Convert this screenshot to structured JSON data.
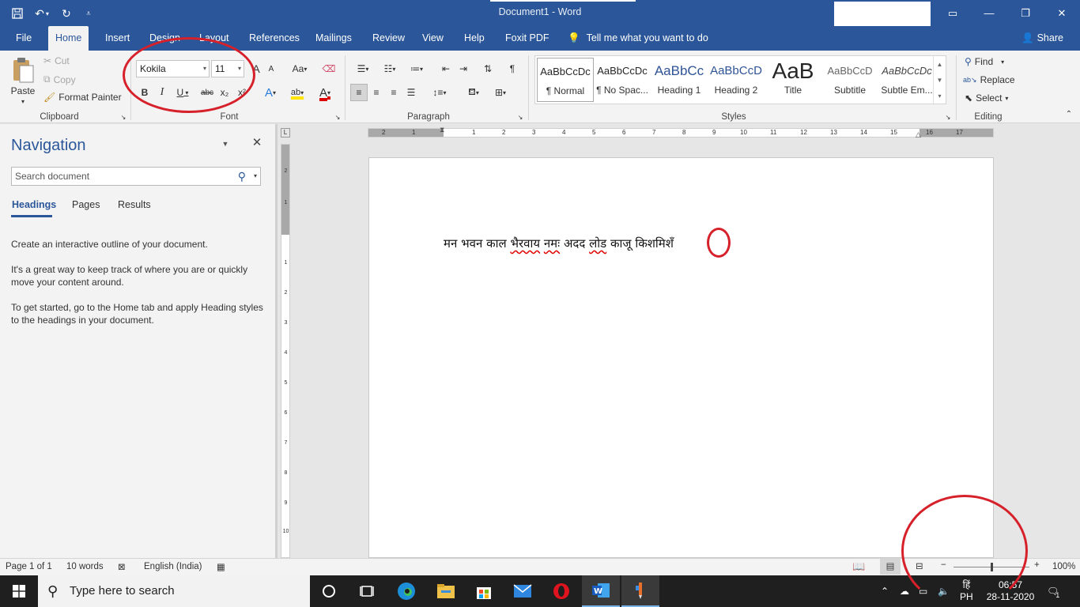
{
  "window": {
    "title": "Document1  -  Word",
    "controls": {
      "ribbon_display": "▭",
      "minimize": "—",
      "restore": "❐",
      "close": "✕"
    }
  },
  "qat": {
    "save": "save-icon",
    "undo": "undo-icon",
    "redo": "redo-icon",
    "customize": "customize-icon"
  },
  "tabs": [
    "File",
    "Home",
    "Insert",
    "Design",
    "Layout",
    "References",
    "Mailings",
    "Review",
    "View",
    "Help",
    "Foxit PDF"
  ],
  "active_tab": "Home",
  "tell_me": "Tell me what you want to do",
  "share": "Share",
  "clipboard": {
    "paste": "Paste",
    "cut": "Cut",
    "copy": "Copy",
    "format_painter": "Format Painter",
    "label": "Clipboard"
  },
  "font": {
    "name": "Kokila",
    "size": "11",
    "label": "Font",
    "buttons": {
      "bold": "B",
      "italic": "I",
      "underline": "U",
      "strike": "abc",
      "sub": "x₂",
      "sup": "x²",
      "grow": "A",
      "shrink": "A",
      "case": "Aa",
      "color": "A",
      "highlight": "ab"
    }
  },
  "paragraph": {
    "label": "Paragraph"
  },
  "styles": {
    "label": "Styles",
    "items": [
      {
        "preview": "AaBbCcDc",
        "name": "¶ Normal"
      },
      {
        "preview": "AaBbCcDc",
        "name": "¶ No Spac..."
      },
      {
        "preview": "AaBbCc",
        "name": "Heading 1"
      },
      {
        "preview": "AaBbCcD",
        "name": "Heading 2"
      },
      {
        "preview": "AaB",
        "name": "Title"
      },
      {
        "preview": "AaBbCcD",
        "name": "Subtitle"
      },
      {
        "preview": "AaBbCcDc",
        "name": "Subtle Em..."
      }
    ]
  },
  "editing": {
    "label": "Editing",
    "find": "Find",
    "replace": "Replace",
    "select": "Select"
  },
  "navigation": {
    "title": "Navigation",
    "search_placeholder": "Search document",
    "tabs": [
      "Headings",
      "Pages",
      "Results"
    ],
    "para1": "Create an interactive outline of your document.",
    "para2": "It's a great way to keep track of where you are or quickly move your content around.",
    "para3": "To get started, go to the Home tab and apply Heading styles to the headings in your document."
  },
  "ruler": {
    "h_ticks": [
      "2",
      "1",
      "1",
      "2",
      "3",
      "4",
      "5",
      "6",
      "7",
      "8",
      "9",
      "10",
      "11",
      "12",
      "13",
      "14",
      "15",
      "16",
      "17",
      "18"
    ],
    "v_ticks": [
      "2",
      "1",
      "1",
      "2",
      "3",
      "4",
      "5",
      "6",
      "7",
      "8",
      "9",
      "10"
    ]
  },
  "document": {
    "words": [
      "मन",
      "भवन",
      "काल",
      "भैरवाय",
      "नमः",
      "अदद",
      "लोड",
      "काजू",
      "किशमिश",
      "ँ"
    ],
    "squiggly": [
      false,
      false,
      false,
      true,
      true,
      false,
      true,
      false,
      false,
      false
    ]
  },
  "status": {
    "page": "Page 1 of 1",
    "words": "10 words",
    "language": "English (India)",
    "zoom_minus": "−",
    "zoom_plus": "+",
    "zoom": "100%"
  },
  "taskbar": {
    "search_placeholder": "Type here to search",
    "ime": "हिं",
    "ime_sub": "PH",
    "time": "06:57",
    "date": "28-11-2020",
    "notifications": "1"
  }
}
